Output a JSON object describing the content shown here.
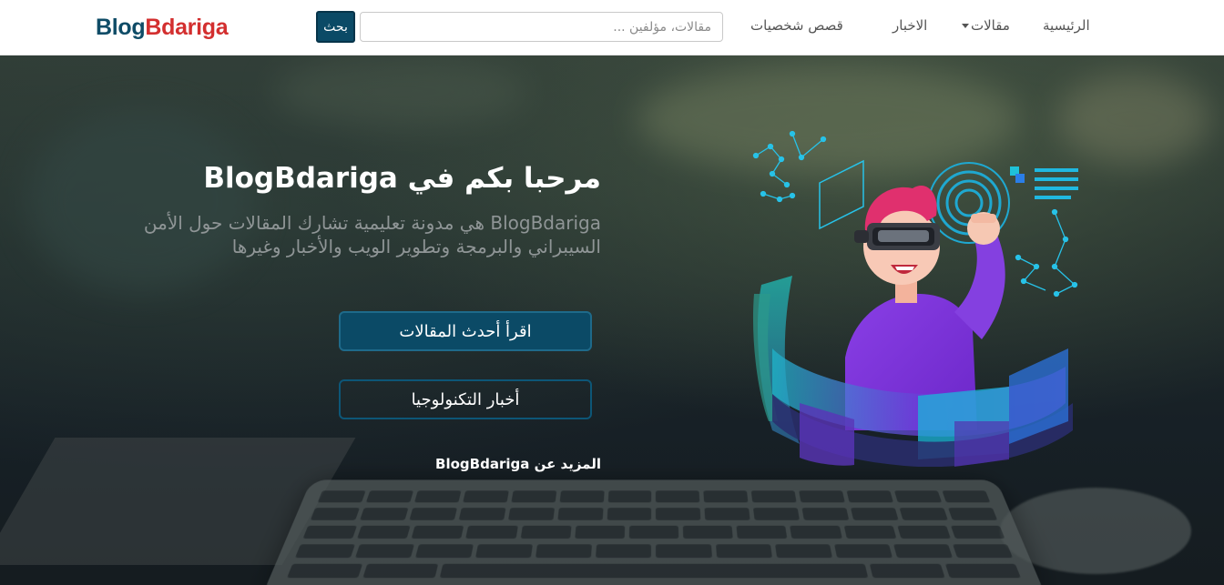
{
  "navbar": {
    "brand_part1": "Blog",
    "brand_part2": "Bdariga",
    "search_button": "بحث",
    "search_placeholder": "مقالات، مؤلفين ...",
    "links": {
      "home": "الرئيسية",
      "articles": "مقالات",
      "news": "الاخبار",
      "stories": "قصص شخصيات"
    }
  },
  "hero": {
    "title": "مرحبا بكم في BlogBdariga",
    "description": "BlogBdariga هي مدونة تعليمية تشارك المقالات حول الأمن السيبراني والبرمجة وتطوير الويب والأخبار وغيرها",
    "primary_button": "اقرأ أحدث المقالات",
    "secondary_button": "أخبار التكنولوجيا",
    "more_link": "المزيد عن BlogBdariga"
  },
  "colors": {
    "brand_blue": "#0f4c67",
    "brand_red": "#d32f2f",
    "button_blue": "#0b4a66"
  }
}
